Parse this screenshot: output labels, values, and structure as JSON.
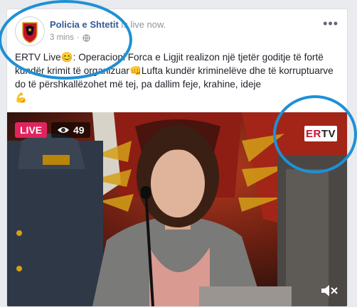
{
  "post": {
    "page_name": "Policia e Shtetit",
    "status": " is live now.",
    "time": "3 mins",
    "separator": "·",
    "more": "•••",
    "text": {
      "part1": "ERTV Live",
      "part2": ": Operacioni Forca e Ligjit realizon një tjetër goditje të fortë kundër krimit të organizuar",
      "part3": "Lufta kundër kriminelëve dhe të korruptuarve do të përshkallëzohet më tej, pa dallim feje, krahine, ideje",
      "emoji_smile": "😊",
      "emoji_fist": "👊",
      "emoji_muscle": "💪"
    }
  },
  "video": {
    "live_label": "LIVE",
    "viewer_count": "49",
    "channel_logo_er": "ER",
    "channel_logo_tv": "TV"
  },
  "colors": {
    "brand_blue": "#365899",
    "live_red": "#e0245e",
    "annotation_blue": "#1e90d6"
  },
  "icons": [
    "globe-icon",
    "eye-icon",
    "mute-icon",
    "more-options-icon"
  ]
}
